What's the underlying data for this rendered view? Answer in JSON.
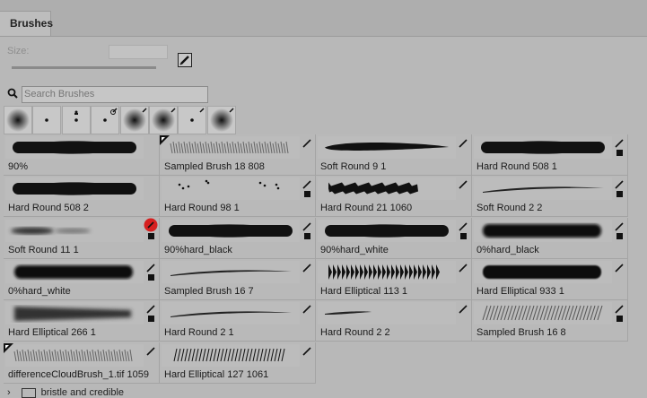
{
  "panel": {
    "tab_label": "Brushes"
  },
  "size": {
    "label": "Size:",
    "value": ""
  },
  "search": {
    "placeholder": "Search Brushes"
  },
  "recent_brushes": [
    {
      "type": "soft-round"
    },
    {
      "type": "dot"
    },
    {
      "type": "dot-person"
    },
    {
      "type": "dot-cloud"
    },
    {
      "type": "soft-round"
    },
    {
      "type": "soft-round"
    },
    {
      "type": "dot"
    },
    {
      "type": "soft-round"
    }
  ],
  "brushes": [
    {
      "name": "90%",
      "stroke": "hard",
      "badge": false,
      "pen": false,
      "square": false
    },
    {
      "name": "Sampled Brush 18 808",
      "stroke": "sampled-light",
      "badge": true,
      "pen": true,
      "square": false
    },
    {
      "name": "Soft Round 9 1",
      "stroke": "taper-thin",
      "badge": false,
      "pen": true,
      "square": false
    },
    {
      "name": "Hard Round 508 1",
      "stroke": "hard",
      "badge": false,
      "pen": true,
      "square": true
    },
    {
      "name": "Hard Round 508 2",
      "stroke": "hard",
      "badge": false,
      "pen": false,
      "square": false
    },
    {
      "name": "Hard Round 98 1",
      "stroke": "splatter",
      "badge": false,
      "pen": true,
      "square": true
    },
    {
      "name": "Hard Round 21 1060",
      "stroke": "rough",
      "badge": false,
      "pen": true,
      "square": false
    },
    {
      "name": "Soft Round 2 2",
      "stroke": "taper-hair",
      "badge": false,
      "pen": true,
      "square": true
    },
    {
      "name": "Soft Round 11 1",
      "stroke": "soft-blob",
      "badge": false,
      "pen": "red",
      "square": true
    },
    {
      "name": "90%hard_black",
      "stroke": "hard",
      "badge": false,
      "pen": true,
      "square": true
    },
    {
      "name": "90%hard_white",
      "stroke": "hard",
      "badge": false,
      "pen": true,
      "square": true
    },
    {
      "name": "0%hard_black",
      "stroke": "fuzzy",
      "badge": false,
      "pen": true,
      "square": true
    },
    {
      "name": "0%hard_white",
      "stroke": "fuzzy",
      "badge": false,
      "pen": true,
      "square": true
    },
    {
      "name": "Sampled Brush 16 7",
      "stroke": "taper-hair",
      "badge": false,
      "pen": true,
      "square": false
    },
    {
      "name": "Hard Elliptical 113 1",
      "stroke": "bristle-dark",
      "badge": false,
      "pen": true,
      "square": false
    },
    {
      "name": "Hard Elliptical 933 1",
      "stroke": "fuzzy-dark",
      "badge": false,
      "pen": true,
      "square": false
    },
    {
      "name": "Hard Elliptical 266 1",
      "stroke": "soft-taper",
      "badge": false,
      "pen": true,
      "square": true
    },
    {
      "name": "Hard Round 2 1",
      "stroke": "taper-hair",
      "badge": false,
      "pen": true,
      "square": false
    },
    {
      "name": "Hard Round 2 2",
      "stroke": "taper-short",
      "badge": false,
      "pen": true,
      "square": false
    },
    {
      "name": "Sampled Brush 16 8",
      "stroke": "grass",
      "badge": false,
      "pen": true,
      "square": true
    },
    {
      "name": "differenceCloudBrush_1.tif 1059",
      "stroke": "grass-light",
      "badge": true,
      "pen": true,
      "square": false
    },
    {
      "name": "Hard Elliptical 127 1061",
      "stroke": "hatch",
      "badge": false,
      "pen": true,
      "square": false
    }
  ],
  "folder": {
    "label": "bristle and credible"
  }
}
